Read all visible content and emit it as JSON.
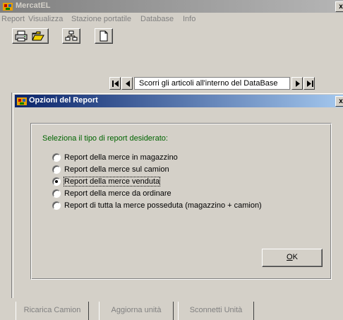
{
  "app": {
    "title": "MercatEL",
    "close_glyph": "x"
  },
  "menu": [
    "Report",
    "Visualizza",
    "Stazione portatile",
    "Database",
    "Info"
  ],
  "toolbar": {
    "print_icon": "printer-icon",
    "open_icon": "folder-open-icon",
    "network_icon": "network-icon",
    "new_icon": "blank-page-icon"
  },
  "navigator": {
    "first_icon": "first-record-icon",
    "prev_icon": "prev-record-icon",
    "label": "Scorri gli articoli all'interno del DataBase",
    "next_icon": "next-record-icon",
    "last_icon": "last-record-icon"
  },
  "dialog": {
    "title": "Opzioni del Report",
    "close_glyph": "x",
    "group_label": "Seleziona il tipo di report desiderato:",
    "options": [
      {
        "label": "Report della merce in magazzino",
        "selected": false
      },
      {
        "label": "Report della merce sul camion",
        "selected": false
      },
      {
        "label": "Report della merce venduta",
        "selected": true
      },
      {
        "label": "Report della merce da ordinare",
        "selected": false
      },
      {
        "label": "Report di tutta la merce posseduta (magazzino + camion)",
        "selected": false
      }
    ],
    "ok_accel": "O",
    "ok_rest": "K"
  },
  "bottom_tabs": [
    "Ricarica Camion",
    "Aggiorna unità",
    "Sconnetti Unità"
  ],
  "colors": {
    "face": "#d4d0c8",
    "active_title": "#0a246a",
    "inactive_title": "#808080",
    "group_label": "#006400"
  }
}
